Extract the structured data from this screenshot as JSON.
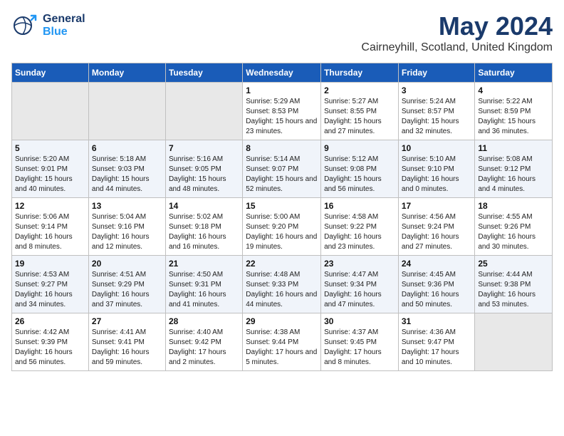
{
  "header": {
    "logo_general": "General",
    "logo_blue": "Blue",
    "title": "May 2024",
    "subtitle": "Cairneyhill, Scotland, United Kingdom"
  },
  "calendar": {
    "days_of_week": [
      "Sunday",
      "Monday",
      "Tuesday",
      "Wednesday",
      "Thursday",
      "Friday",
      "Saturday"
    ],
    "weeks": [
      {
        "cells": [
          {
            "day": "",
            "info": ""
          },
          {
            "day": "",
            "info": ""
          },
          {
            "day": "",
            "info": ""
          },
          {
            "day": "1",
            "info": "Sunrise: 5:29 AM\nSunset: 8:53 PM\nDaylight: 15 hours\nand 23 minutes."
          },
          {
            "day": "2",
            "info": "Sunrise: 5:27 AM\nSunset: 8:55 PM\nDaylight: 15 hours\nand 27 minutes."
          },
          {
            "day": "3",
            "info": "Sunrise: 5:24 AM\nSunset: 8:57 PM\nDaylight: 15 hours\nand 32 minutes."
          },
          {
            "day": "4",
            "info": "Sunrise: 5:22 AM\nSunset: 8:59 PM\nDaylight: 15 hours\nand 36 minutes."
          }
        ]
      },
      {
        "cells": [
          {
            "day": "5",
            "info": "Sunrise: 5:20 AM\nSunset: 9:01 PM\nDaylight: 15 hours\nand 40 minutes."
          },
          {
            "day": "6",
            "info": "Sunrise: 5:18 AM\nSunset: 9:03 PM\nDaylight: 15 hours\nand 44 minutes."
          },
          {
            "day": "7",
            "info": "Sunrise: 5:16 AM\nSunset: 9:05 PM\nDaylight: 15 hours\nand 48 minutes."
          },
          {
            "day": "8",
            "info": "Sunrise: 5:14 AM\nSunset: 9:07 PM\nDaylight: 15 hours\nand 52 minutes."
          },
          {
            "day": "9",
            "info": "Sunrise: 5:12 AM\nSunset: 9:08 PM\nDaylight: 15 hours\nand 56 minutes."
          },
          {
            "day": "10",
            "info": "Sunrise: 5:10 AM\nSunset: 9:10 PM\nDaylight: 16 hours\nand 0 minutes."
          },
          {
            "day": "11",
            "info": "Sunrise: 5:08 AM\nSunset: 9:12 PM\nDaylight: 16 hours\nand 4 minutes."
          }
        ]
      },
      {
        "cells": [
          {
            "day": "12",
            "info": "Sunrise: 5:06 AM\nSunset: 9:14 PM\nDaylight: 16 hours\nand 8 minutes."
          },
          {
            "day": "13",
            "info": "Sunrise: 5:04 AM\nSunset: 9:16 PM\nDaylight: 16 hours\nand 12 minutes."
          },
          {
            "day": "14",
            "info": "Sunrise: 5:02 AM\nSunset: 9:18 PM\nDaylight: 16 hours\nand 16 minutes."
          },
          {
            "day": "15",
            "info": "Sunrise: 5:00 AM\nSunset: 9:20 PM\nDaylight: 16 hours\nand 19 minutes."
          },
          {
            "day": "16",
            "info": "Sunrise: 4:58 AM\nSunset: 9:22 PM\nDaylight: 16 hours\nand 23 minutes."
          },
          {
            "day": "17",
            "info": "Sunrise: 4:56 AM\nSunset: 9:24 PM\nDaylight: 16 hours\nand 27 minutes."
          },
          {
            "day": "18",
            "info": "Sunrise: 4:55 AM\nSunset: 9:26 PM\nDaylight: 16 hours\nand 30 minutes."
          }
        ]
      },
      {
        "cells": [
          {
            "day": "19",
            "info": "Sunrise: 4:53 AM\nSunset: 9:27 PM\nDaylight: 16 hours\nand 34 minutes."
          },
          {
            "day": "20",
            "info": "Sunrise: 4:51 AM\nSunset: 9:29 PM\nDaylight: 16 hours\nand 37 minutes."
          },
          {
            "day": "21",
            "info": "Sunrise: 4:50 AM\nSunset: 9:31 PM\nDaylight: 16 hours\nand 41 minutes."
          },
          {
            "day": "22",
            "info": "Sunrise: 4:48 AM\nSunset: 9:33 PM\nDaylight: 16 hours\nand 44 minutes."
          },
          {
            "day": "23",
            "info": "Sunrise: 4:47 AM\nSunset: 9:34 PM\nDaylight: 16 hours\nand 47 minutes."
          },
          {
            "day": "24",
            "info": "Sunrise: 4:45 AM\nSunset: 9:36 PM\nDaylight: 16 hours\nand 50 minutes."
          },
          {
            "day": "25",
            "info": "Sunrise: 4:44 AM\nSunset: 9:38 PM\nDaylight: 16 hours\nand 53 minutes."
          }
        ]
      },
      {
        "cells": [
          {
            "day": "26",
            "info": "Sunrise: 4:42 AM\nSunset: 9:39 PM\nDaylight: 16 hours\nand 56 minutes."
          },
          {
            "day": "27",
            "info": "Sunrise: 4:41 AM\nSunset: 9:41 PM\nDaylight: 16 hours\nand 59 minutes."
          },
          {
            "day": "28",
            "info": "Sunrise: 4:40 AM\nSunset: 9:42 PM\nDaylight: 17 hours\nand 2 minutes."
          },
          {
            "day": "29",
            "info": "Sunrise: 4:38 AM\nSunset: 9:44 PM\nDaylight: 17 hours\nand 5 minutes."
          },
          {
            "day": "30",
            "info": "Sunrise: 4:37 AM\nSunset: 9:45 PM\nDaylight: 17 hours\nand 8 minutes."
          },
          {
            "day": "31",
            "info": "Sunrise: 4:36 AM\nSunset: 9:47 PM\nDaylight: 17 hours\nand 10 minutes."
          },
          {
            "day": "",
            "info": ""
          }
        ]
      }
    ]
  }
}
